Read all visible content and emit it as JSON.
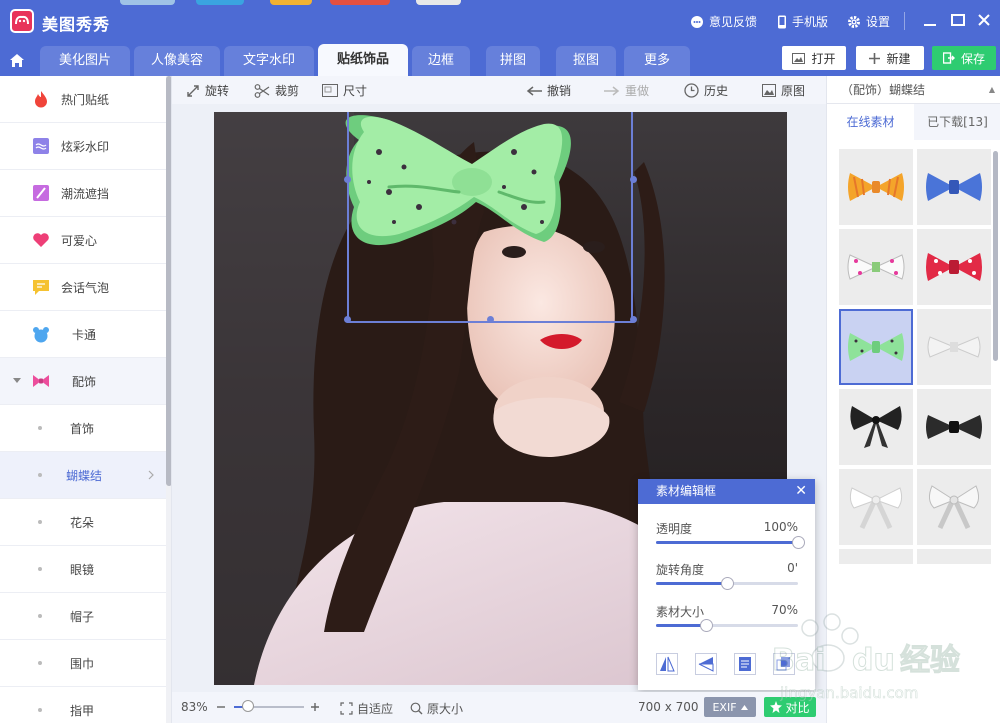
{
  "app": {
    "title": "美图秀秀"
  },
  "titlebar": {
    "feedback": "意见反馈",
    "mobile": "手机版",
    "settings": "设置"
  },
  "tabs": [
    {
      "label": "美化图片"
    },
    {
      "label": "人像美容"
    },
    {
      "label": "文字水印"
    },
    {
      "label": "贴纸饰品",
      "active": true
    },
    {
      "label": "边框"
    },
    {
      "label": "拼图"
    },
    {
      "label": "抠图"
    },
    {
      "label": "更多"
    }
  ],
  "actions": {
    "open": "打开",
    "new": "新建",
    "save": "保存"
  },
  "sidebar": {
    "items": [
      {
        "label": "热门贴纸",
        "icon": "flame-icon"
      },
      {
        "label": "炫彩水印",
        "icon": "watermark-icon"
      },
      {
        "label": "潮流遮挡",
        "icon": "slash-icon"
      },
      {
        "label": "可爱心",
        "icon": "heart-icon"
      },
      {
        "label": "会话气泡",
        "icon": "speech-bubble-icon"
      },
      {
        "label": "卡通",
        "icon": "bear-icon"
      },
      {
        "label": "配饰",
        "icon": "bow-icon",
        "expanded": true
      }
    ],
    "subitems": [
      {
        "label": "首饰"
      },
      {
        "label": "蝴蝶结",
        "selected": true
      },
      {
        "label": "花朵"
      },
      {
        "label": "眼镜"
      },
      {
        "label": "帽子"
      },
      {
        "label": "围巾"
      },
      {
        "label": "指甲"
      }
    ]
  },
  "toolbar": {
    "rotate": "旋转",
    "crop": "裁剪",
    "size": "尺寸",
    "undo": "撤销",
    "redo": "重做",
    "history": "历史",
    "original": "原图"
  },
  "editpanel": {
    "title": "素材编辑框",
    "opacity_label": "透明度",
    "opacity_value": "100%",
    "opacity_level": 1.0,
    "rotation_label": "旋转角度",
    "rotation_value": "0'",
    "rotation_level": 0.5,
    "size_label": "素材大小",
    "size_value": "70%",
    "size_level": 0.35
  },
  "bottombar": {
    "zoom": "83%",
    "fit": "自适应",
    "actual": "原大小",
    "dimensions": "700 x 700",
    "exif": "EXIF",
    "compare": "对比"
  },
  "rightpanel": {
    "category": "（配饰）蝴蝶结",
    "tab_online": "在线素材",
    "tab_downloaded": "已下载[13]"
  },
  "watermark": {
    "brand": "Baidu经验",
    "url": "jingyan.baidu.com"
  },
  "colors": {
    "brand_blue": "#4d6bd4",
    "save_green": "#2ecc71",
    "logo_red": "#e8335a"
  }
}
